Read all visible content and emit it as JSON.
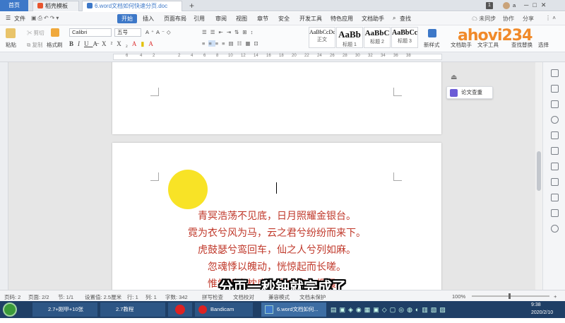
{
  "titlebar": {
    "home_tab": "首页",
    "template_tab": "稻壳模板",
    "doc_tab": "6.word文档如何快速分页.doc",
    "add_tab": "+",
    "badge_count": "1",
    "user": "a"
  },
  "menubar": {
    "file": "文件",
    "start": "开始",
    "items": [
      "插入",
      "页面布局",
      "引用",
      "审阅",
      "视图",
      "章节",
      "安全",
      "开发工具",
      "特色应用",
      "文档助手"
    ],
    "search": "查找",
    "sync": "未同步",
    "collab": "协作",
    "share": "分享"
  },
  "ribbon": {
    "paste": "粘贴",
    "cut": "剪切",
    "copy": "复制",
    "format_painter": "格式刷",
    "font": "Calibri",
    "font_size": "五号",
    "styles": [
      {
        "sample": "AaBbCcDd",
        "label": "正文"
      },
      {
        "sample": "AaBb",
        "label": "标题 1"
      },
      {
        "sample": "AaBbC",
        "label": "标题 2"
      },
      {
        "sample": "AaBbCc",
        "label": "标题 3"
      }
    ],
    "new_style": "新样式",
    "doc_assistant": "文档助手",
    "text_tools": "文字工具",
    "find_replace": "查找替换",
    "select": "选择"
  },
  "ruler": {
    "ticks": [
      "6",
      "4",
      "2",
      "2",
      "4",
      "6",
      "8",
      "10",
      "12",
      "14",
      "16",
      "18",
      "20",
      "22",
      "24",
      "26",
      "28",
      "30",
      "32",
      "34",
      "36",
      "38"
    ]
  },
  "document": {
    "poem_lines": [
      "青冥浩荡不见底，日月照耀金银台。",
      "霓为衣兮风为马，云之君兮纷纷而来下。",
      "虎鼓瑟兮鸾回车，仙之人兮列如麻。",
      "忽魂悸以魄动，恍惊起而长嗟。",
      "惟觉时之枕席，失向来之烟霞。"
    ],
    "poem_color": "#c0392b"
  },
  "side_popup": {
    "paper_check": "论文查重"
  },
  "statusbar": {
    "page": "页码: 2",
    "pages": "页面: 2/2",
    "section": "节: 1/1",
    "setting": "设置值: 2.5厘米",
    "row": "行: 1",
    "col": "列: 1",
    "chars": "字数: 342",
    "spell": "拼写检查",
    "doc_check": "文档校对",
    "compat": "兼容模式",
    "protect": "文档未保护",
    "zoom": "100%"
  },
  "taskbar": {
    "items": [
      "2.7+刚甲+10张",
      "2.7教程",
      "",
      "Bandicam",
      "6.word文档如何..."
    ],
    "time": "9:38",
    "date": "2020/2/10"
  },
  "overlay": {
    "subtitle": "分页一秒钟就完成了",
    "logo": "ahovi234"
  }
}
